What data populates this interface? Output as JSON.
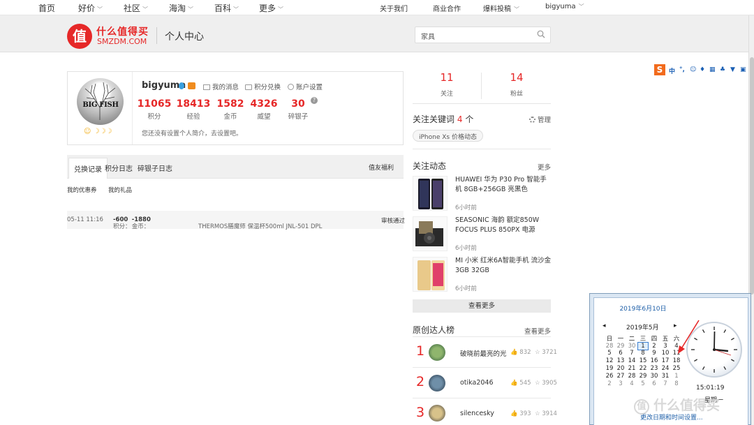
{
  "topnav": {
    "left": [
      {
        "label": "首页",
        "chevron": false
      },
      {
        "label": "好价",
        "chevron": true
      },
      {
        "label": "社区",
        "chevron": true
      },
      {
        "label": "海淘",
        "chevron": true
      },
      {
        "label": "百科",
        "chevron": true
      },
      {
        "label": "更多",
        "chevron": true
      }
    ],
    "right": {
      "about": "关于我们",
      "biz": "商业合作",
      "submit": "爆料投稿",
      "user": "bigyuma"
    }
  },
  "header": {
    "logo_glyph": "值",
    "logo_cn": "什么值得买",
    "logo_en": "SMZDM.COM",
    "title": "个人中心",
    "search_value": "家具",
    "accent": "#e62828"
  },
  "profile": {
    "avatar_text": "BIG FISH",
    "username": "bigyuma",
    "links": {
      "messages": "我的消息",
      "exchange": "积分兑换",
      "settings": "账户设置"
    },
    "stats": [
      {
        "value": "11065",
        "label": "积分"
      },
      {
        "value": "18413",
        "label": "经验"
      },
      {
        "value": "1582",
        "label": "金币"
      },
      {
        "value": "4326",
        "label": "威望"
      },
      {
        "value": "30",
        "label": "碎银子"
      }
    ],
    "help_glyph": "?",
    "intro": "您还没有设置个人简介，去设置吧。"
  },
  "tabs": {
    "items": [
      "兑换记录",
      "积分日志",
      "碎银子日志"
    ],
    "right": "值友福利",
    "sub": [
      "我的优惠券",
      "我的礼品"
    ]
  },
  "record": {
    "time": "05-11 11:16",
    "points_label": "积分：",
    "points": "-600",
    "coins_label": "金币：",
    "coins": "-1880",
    "item": "THERMOS膳魔师 保温杯500ml JNL-501 DPL",
    "status": "审核通过"
  },
  "follow": {
    "following": {
      "value": "11",
      "label": "关注"
    },
    "fans": {
      "value": "14",
      "label": "粉丝"
    }
  },
  "keywords": {
    "title_prefix": "关注关键词",
    "count": "4",
    "title_suffix": "个",
    "manage": "管理",
    "tag": "iPhone Xs 价格动态"
  },
  "dynamics": {
    "title": "关注动态",
    "more": "更多",
    "items": [
      {
        "title": "HUAWEI 华为 P30 Pro 智能手机 8GB+256GB 亮黑色",
        "time": "6小时前"
      },
      {
        "title": "SEASONIC 海韵 额定850W FOCUS PLUS 850PX 电源",
        "time": "6小时前"
      },
      {
        "title": "MI 小米 红米6A智能手机 流沙金 3GB 32GB",
        "time": "6小时前"
      }
    ],
    "view_more": "查看更多"
  },
  "ranking": {
    "title": "原创达人榜",
    "more": "查看更多",
    "items": [
      {
        "rank": "1",
        "name": "破晓前最亮的光",
        "likes": "832",
        "stars": "3721"
      },
      {
        "rank": "2",
        "name": "otika2046",
        "likes": "545",
        "stars": "3905"
      },
      {
        "rank": "3",
        "name": "silencesky",
        "likes": "393",
        "stars": "3914"
      }
    ]
  },
  "sogou": {
    "logo": "S",
    "lang": "中"
  },
  "calendar": {
    "date": "2019年6月10日",
    "month": "2019年5月",
    "weekdays": [
      "日",
      "一",
      "二",
      "三",
      "四",
      "五",
      "六"
    ],
    "weeks": [
      [
        "28",
        "29",
        "30",
        "1",
        "2",
        "3",
        "4"
      ],
      [
        "5",
        "6",
        "7",
        "8",
        "9",
        "10",
        "11"
      ],
      [
        "12",
        "13",
        "14",
        "15",
        "16",
        "17",
        "18"
      ],
      [
        "19",
        "20",
        "21",
        "22",
        "23",
        "24",
        "25"
      ],
      [
        "26",
        "27",
        "28",
        "29",
        "30",
        "31",
        "1"
      ],
      [
        "2",
        "3",
        "4",
        "5",
        "6",
        "7",
        "8"
      ]
    ],
    "time": "15:01:19",
    "weekday": "星期一",
    "link": "更改日期和时间设置..."
  },
  "watermark": {
    "glyph": "值",
    "text": "什么值得买"
  }
}
